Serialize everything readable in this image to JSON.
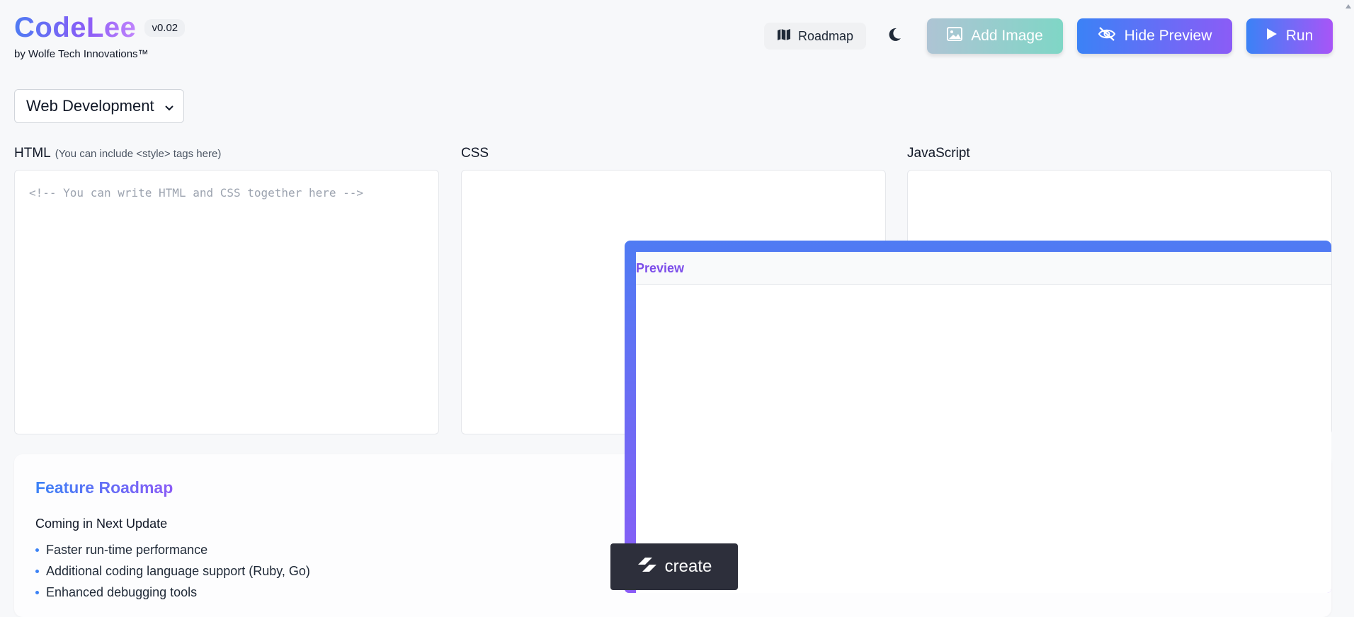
{
  "brand": {
    "name": "CodeLee",
    "version": "v0.02",
    "tagline": "by Wolfe Tech Innovations™"
  },
  "toolbar": {
    "roadmap_label": "Roadmap",
    "add_image_label": "Add Image",
    "hide_preview_label": "Hide Preview",
    "run_label": "Run"
  },
  "mode_select": {
    "selected": "Web Development"
  },
  "editors": {
    "html": {
      "label": "HTML",
      "hint": "(You can include <style> tags here)",
      "placeholder": "<!-- You can write HTML and CSS together here -->"
    },
    "css": {
      "label": "CSS"
    },
    "js": {
      "label": "JavaScript"
    }
  },
  "roadmap": {
    "title": "Feature Roadmap",
    "subtitle": "Coming in Next Update",
    "items": [
      "Faster run-time performance",
      "Additional coding language support (Ruby, Go)",
      "Enhanced debugging tools"
    ]
  },
  "preview": {
    "title": "Preview"
  },
  "create_badge": {
    "label": "create"
  },
  "colors": {
    "accent_blue": "#3b82f6",
    "accent_purple": "#8b5cf6"
  }
}
